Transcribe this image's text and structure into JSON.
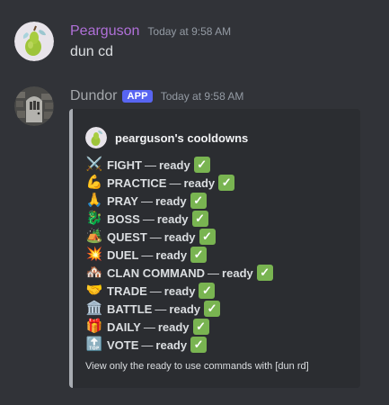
{
  "messages": [
    {
      "author": "Pearguson",
      "timestamp": "Today at 9:58 AM",
      "text": "dun cd",
      "avatar_icon": "pear-icon"
    },
    {
      "author": "Dundor",
      "badge": "APP",
      "timestamp": "Today at 9:58 AM",
      "avatar_icon": "stone-door-icon",
      "embed": {
        "author": "pearguson's cooldowns",
        "author_icon": "pear-icon",
        "footer": "View only the ready to use commands with [dun rd]",
        "border_color": "#a8acb2",
        "cooldowns": [
          {
            "icon": "⚔️",
            "icon_name": "crossed-swords-icon",
            "name": "FIGHT",
            "sep": "—",
            "status": "ready"
          },
          {
            "icon": "💪",
            "icon_name": "flexed-arm-icon",
            "name": "PRACTICE",
            "sep": "—",
            "status": "ready"
          },
          {
            "icon": "🙏",
            "icon_name": "praying-hands-icon",
            "name": "PRAY",
            "sep": "—",
            "status": "ready"
          },
          {
            "icon": "🐉",
            "icon_name": "dragon-icon",
            "name": "BOSS",
            "sep": "—",
            "status": "ready"
          },
          {
            "icon": "🏕️",
            "icon_name": "camping-icon",
            "name": "QUEST",
            "sep": "—",
            "status": "ready"
          },
          {
            "icon": "💥",
            "icon_name": "collision-icon",
            "name": "DUEL",
            "sep": "—",
            "status": "ready"
          },
          {
            "icon": "🏘️",
            "icon_name": "houses-icon",
            "name": "CLAN COMMAND",
            "sep": "—",
            "status": "ready"
          },
          {
            "icon": "🤝",
            "icon_name": "handshake-icon",
            "name": "TRADE",
            "sep": "—",
            "status": "ready"
          },
          {
            "icon": "🏛️",
            "icon_name": "classical-building-icon",
            "name": "BATTLE",
            "sep": "—",
            "status": "ready"
          },
          {
            "icon": "🎁",
            "icon_name": "gift-icon",
            "name": "DAILY",
            "sep": "—",
            "status": "ready"
          },
          {
            "icon": "🔝",
            "icon_name": "top-arrow-icon",
            "name": "VOTE",
            "sep": "—",
            "status": "ready"
          }
        ],
        "check_icon": "white-check-mark-icon",
        "check_glyph": "✓"
      }
    }
  ],
  "colors": {
    "background": "#313338",
    "embed_background": "#2b2d31",
    "pearguson_name": "#b070d8",
    "dundor_name": "#a4a7ab",
    "app_badge": "#5865f2",
    "check_green": "#79b451"
  }
}
